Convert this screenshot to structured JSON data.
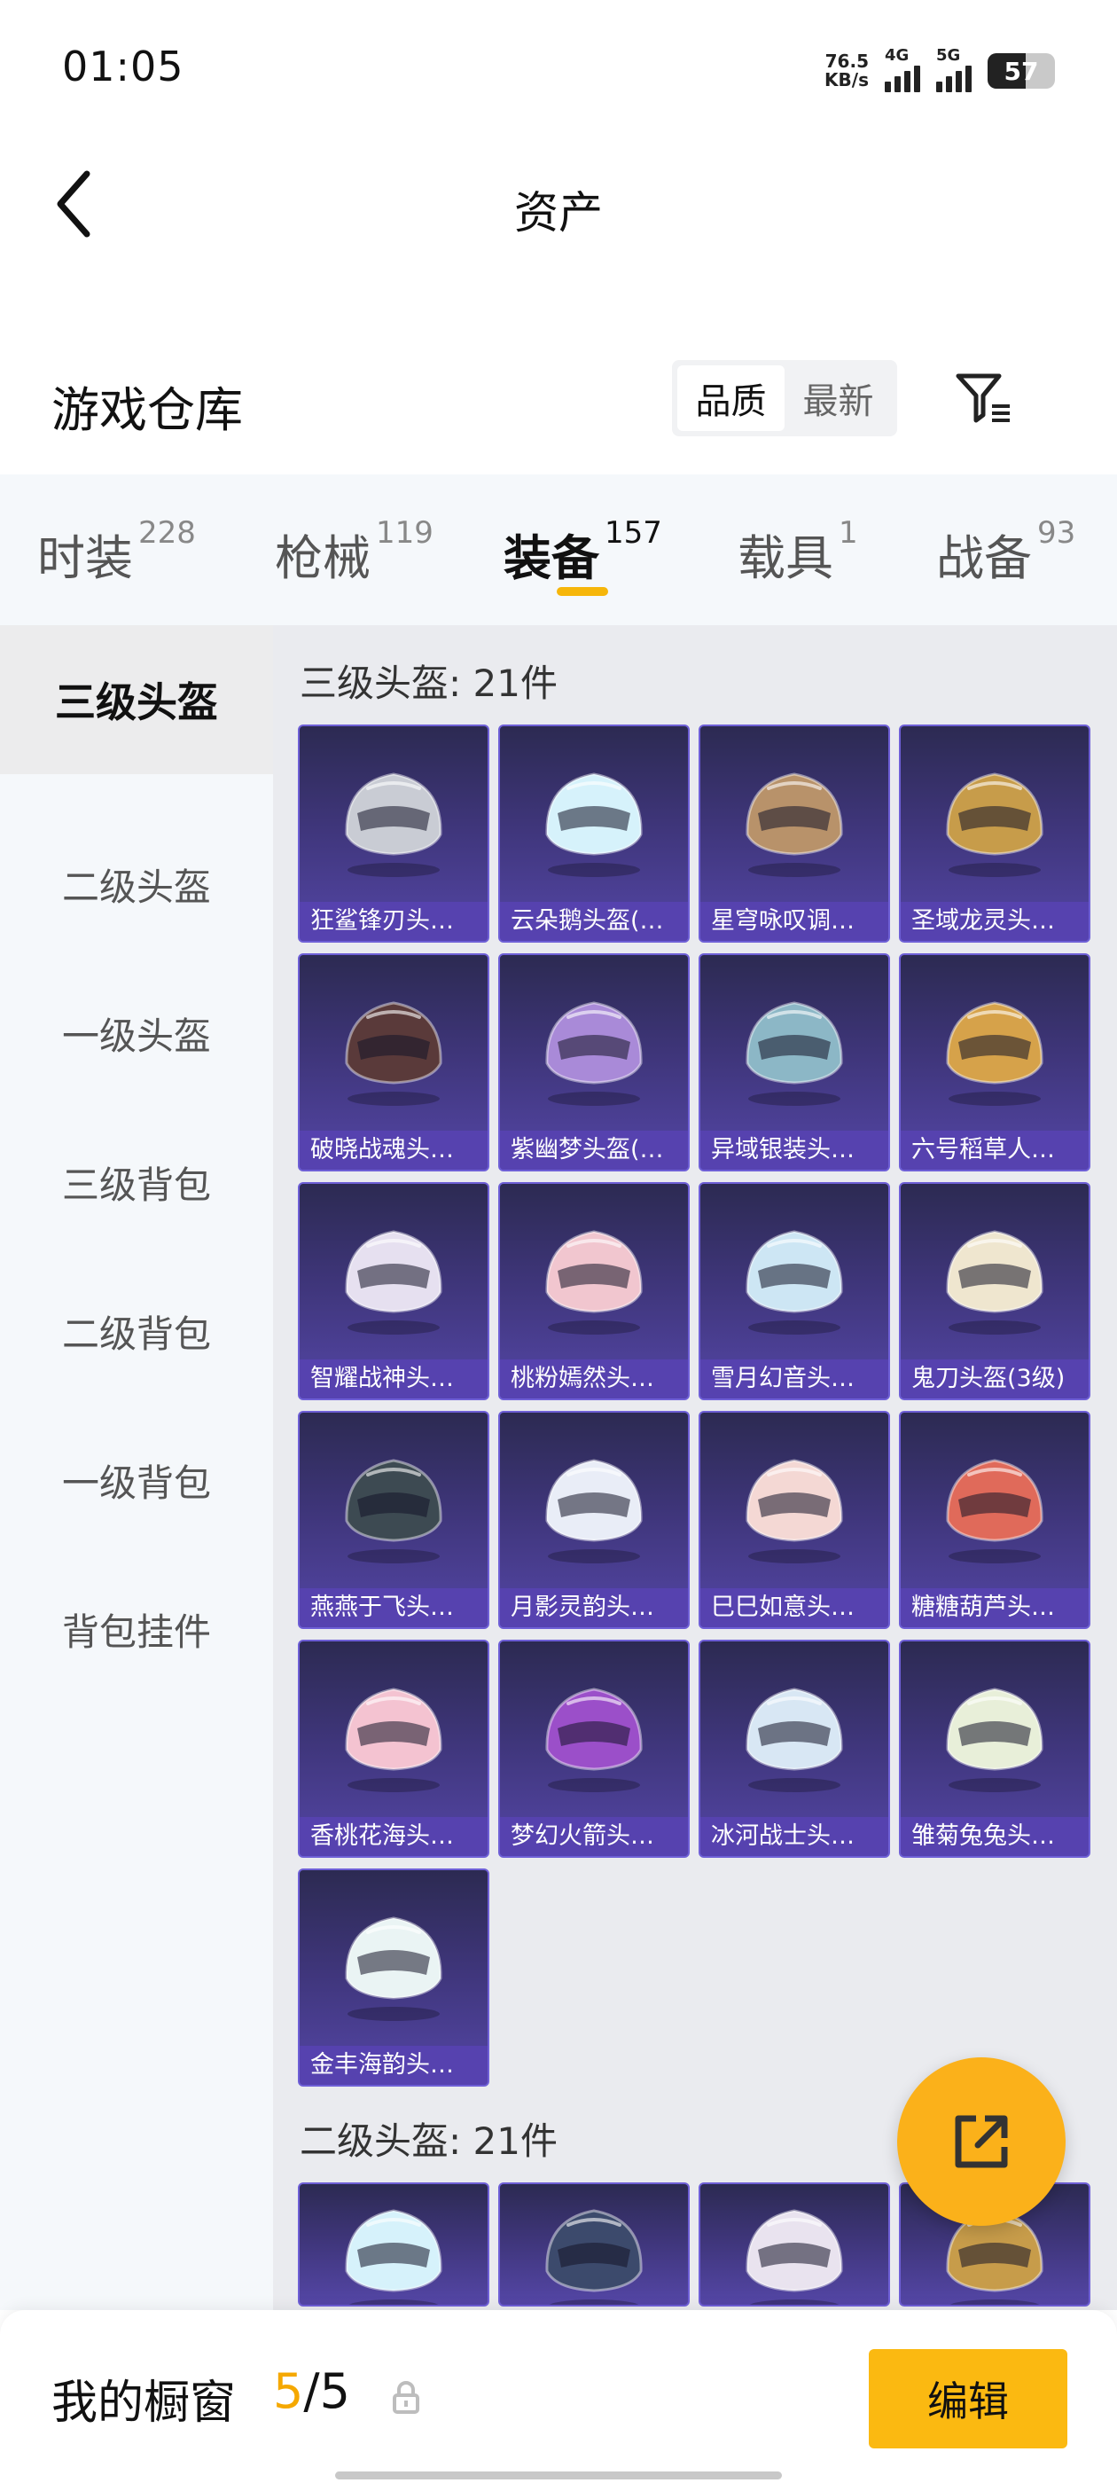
{
  "status_bar": {
    "time": "01:05",
    "net_speed_value": "76.5",
    "net_speed_unit": "KB/s",
    "signal1_label": "4G",
    "signal2_label": "5G",
    "battery_level": "57"
  },
  "header": {
    "title": "资产"
  },
  "warehouse": {
    "title": "游戏仓库",
    "sort_options": [
      "品质",
      "最新"
    ],
    "active_sort": "品质"
  },
  "category_tabs": [
    {
      "label": "时装",
      "count": "228"
    },
    {
      "label": "枪械",
      "count": "119"
    },
    {
      "label": "装备",
      "count": "157",
      "active": true
    },
    {
      "label": "载具",
      "count": "1"
    },
    {
      "label": "战备",
      "count": "93"
    }
  ],
  "side_menu": [
    {
      "label": "三级头盔",
      "active": true
    },
    {
      "label": "二级头盔"
    },
    {
      "label": "一级头盔"
    },
    {
      "label": "三级背包"
    },
    {
      "label": "二级背包"
    },
    {
      "label": "一级背包"
    },
    {
      "label": "背包挂件"
    }
  ],
  "groups": [
    {
      "heading": "三级头盔: 21件",
      "items": [
        {
          "name": "狂鲨锋刃头…",
          "color": "#c9ccd4"
        },
        {
          "name": "云朵鹅头盔(…",
          "color": "#d6f2fb"
        },
        {
          "name": "星穹咏叹调…",
          "color": "#b8926a"
        },
        {
          "name": "圣域龙灵头…",
          "color": "#c79c4a"
        },
        {
          "name": "破晓战魂头…",
          "color": "#5a3a3a"
        },
        {
          "name": "紫幽梦头盔(…",
          "color": "#a98ad8"
        },
        {
          "name": "异域银装头…",
          "color": "#8cb7c6"
        },
        {
          "name": "六号稻草人…",
          "color": "#d6a24a"
        },
        {
          "name": "智耀战神头…",
          "color": "#e6e0f0"
        },
        {
          "name": "桃粉嫣然头…",
          "color": "#f1c6cf"
        },
        {
          "name": "雪月幻音头…",
          "color": "#cde6f4"
        },
        {
          "name": "鬼刀头盔(3级)",
          "color": "#efe6cf"
        },
        {
          "name": "燕燕于飞头…",
          "color": "#3d4a52"
        },
        {
          "name": "月影灵韵头…",
          "color": "#e9edf7"
        },
        {
          "name": "巳巳如意头…",
          "color": "#f4d8d4"
        },
        {
          "name": "糖糖葫芦头…",
          "color": "#e06a5a"
        },
        {
          "name": "香桃花海头…",
          "color": "#f4c3d1"
        },
        {
          "name": "梦幻火箭头…",
          "color": "#9b4fc9"
        },
        {
          "name": "冰河战士头…",
          "color": "#d8e7f4"
        },
        {
          "name": "雏菊兔兔头…",
          "color": "#e8efd9"
        },
        {
          "name": "金丰海韵头…",
          "color": "#eaf4f4"
        }
      ]
    },
    {
      "heading": "二级头盔: 21件",
      "items": [
        {
          "name": "",
          "color": "#d6f2fb"
        },
        {
          "name": "",
          "color": "#3c4a6c"
        },
        {
          "name": "",
          "color": "#e9e3ef"
        },
        {
          "name": "",
          "color": "#c79c4a"
        }
      ]
    }
  ],
  "bottom_bar": {
    "showcase_label": "我的橱窗",
    "showcase_current": "5",
    "showcase_separator": "/",
    "showcase_total": "5",
    "edit_label": "编辑"
  }
}
